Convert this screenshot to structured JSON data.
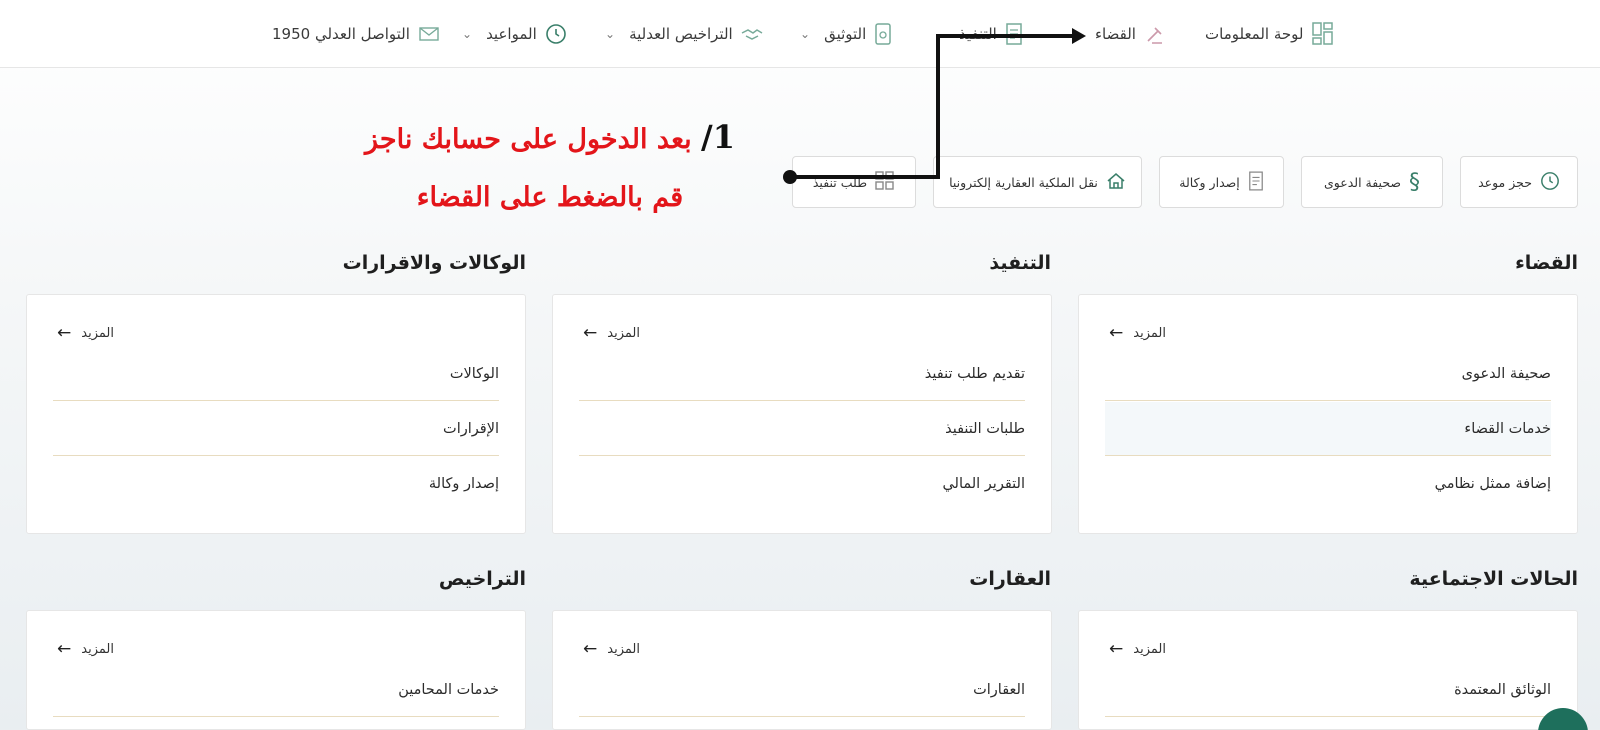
{
  "nav": {
    "dashboard": "لوحة المعلومات",
    "judiciary": "القضاء",
    "execution": "التنفيذ",
    "notarization": "التوثيق",
    "licenses": "التراخيص العدلية",
    "appointments": "المواعيد",
    "contact": "التواصل العدلي 1950"
  },
  "quick": {
    "book_appointment": "حجز موعد",
    "lawsuit_sheet": "صحيفة الدعوى",
    "issue_poa": "إصدار وكالة",
    "property_transfer": "نقل الملكية العقارية إلكترونيا",
    "execution_request": "طلب تنفيذ"
  },
  "annotation": {
    "number": "1/",
    "line1": "بعد الدخول على حسابك ناجز",
    "line2": "قم بالضغط على القضاء"
  },
  "sections": {
    "judiciary": {
      "title": "القضاء",
      "more": "المزيد",
      "items": [
        "صحيفة الدعوى",
        "خدمات القضاء",
        "إضافة ممثل نظامي"
      ]
    },
    "execution": {
      "title": "التنفيذ",
      "more": "المزيد",
      "items": [
        "تقديم طلب تنفيذ",
        "طلبات التنفيذ",
        "التقرير المالي"
      ]
    },
    "poa": {
      "title": "الوكالات والاقرارات",
      "more": "المزيد",
      "items": [
        "الوكالات",
        "الإقرارات",
        "إصدار وكالة"
      ]
    },
    "social": {
      "title": "الحالات الاجتماعية",
      "more": "المزيد",
      "items": [
        "الوثائق المعتمدة"
      ]
    },
    "realestate": {
      "title": "العقارات",
      "more": "المزيد",
      "items": [
        "العقارات"
      ]
    },
    "licenses": {
      "title": "التراخيص",
      "more": "المزيد",
      "items": [
        "خدمات المحامين"
      ]
    }
  },
  "colors": {
    "annotation_red": "#e3151a",
    "accent_green": "#1e6f5c",
    "divider_gold": "#e8dcc0"
  }
}
